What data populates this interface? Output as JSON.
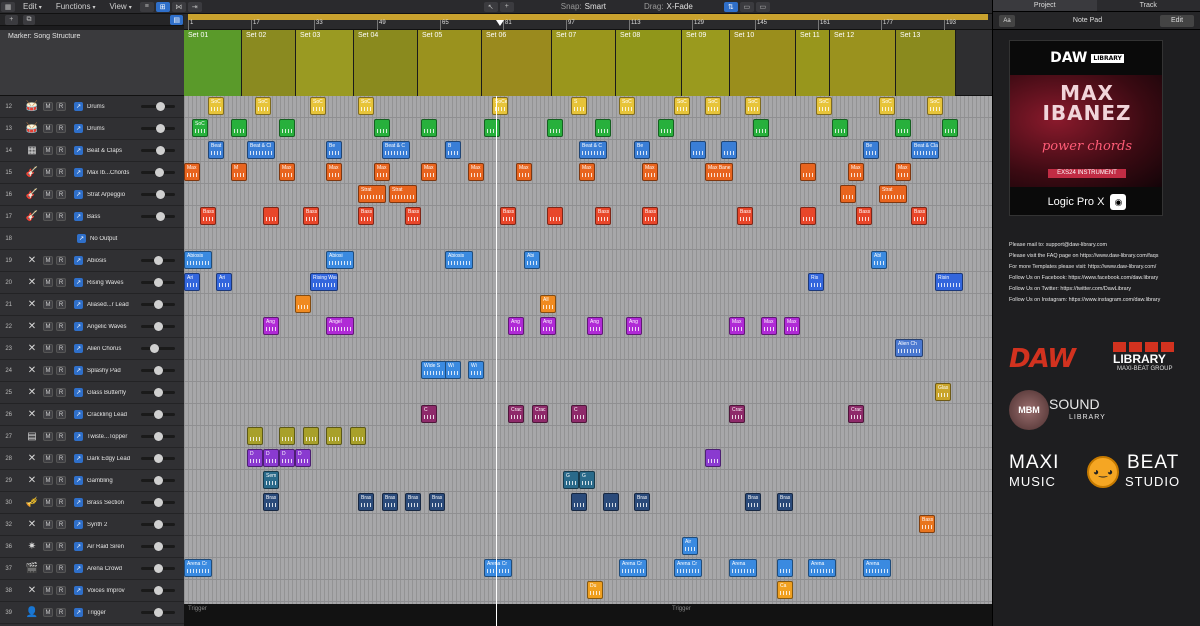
{
  "menubar": {
    "items": [
      {
        "label": "Edit"
      },
      {
        "label": "Functions"
      },
      {
        "label": "View"
      }
    ],
    "snap_label": "Snap:",
    "snap_value": "Smart",
    "drag_label": "Drag:",
    "drag_value": "X-Fade"
  },
  "ruler": {
    "ticks": [
      "1",
      "17",
      "33",
      "49",
      "65",
      "81",
      "97",
      "113",
      "129",
      "145",
      "161",
      "177",
      "193"
    ]
  },
  "marker_track": {
    "label": "Marker: Song Structure",
    "sets": [
      "Set 01",
      "Set 02",
      "Set 03",
      "Set 04",
      "Set 05",
      "Set 06",
      "Set 07",
      "Set 08",
      "Set 09",
      "Set 10",
      "Set 11",
      "Set 12",
      "Set 13"
    ]
  },
  "tracks": [
    {
      "num": "12",
      "name": "Drums",
      "icon": "drum-kit-icon",
      "color": "#e7c43a"
    },
    {
      "num": "13",
      "name": "Drums",
      "icon": "drum-kit-icon",
      "color": "#27b03c"
    },
    {
      "num": "14",
      "name": "Beat & Claps",
      "icon": "drum-machine-icon",
      "color": "#3a7ed6"
    },
    {
      "num": "15",
      "name": "Max Ib...Chords",
      "icon": "guitar-icon",
      "color": "#e8641e"
    },
    {
      "num": "16",
      "name": "Strat Arpeggio",
      "icon": "guitar-icon",
      "color": "#e8641e"
    },
    {
      "num": "17",
      "name": "Bass",
      "icon": "bass-guitar-icon",
      "color": "#e8462a"
    },
    {
      "num": "18",
      "name": "No Output",
      "icon": "none",
      "color": "#a7a7a9"
    },
    {
      "num": "19",
      "name": "Abiosis",
      "icon": "synth-icon",
      "color": "#3a8ae0"
    },
    {
      "num": "20",
      "name": "Rising Waves",
      "icon": "synth-icon",
      "color": "#3366dd"
    },
    {
      "num": "21",
      "name": "Aliased...r Lead",
      "icon": "synth-icon",
      "color": "#f08a20"
    },
    {
      "num": "22",
      "name": "Angelic Waves",
      "icon": "synth-icon",
      "color": "#b02ad6"
    },
    {
      "num": "23",
      "name": "Alien Chorus",
      "icon": "synth-icon",
      "color": "#4a78d0"
    },
    {
      "num": "24",
      "name": "Splashy Pad",
      "icon": "synth-icon",
      "color": "#3a8ae0"
    },
    {
      "num": "25",
      "name": "Glass Butterfly",
      "icon": "synth-icon",
      "color": "#c9a42a"
    },
    {
      "num": "26",
      "name": "Crackling Lead",
      "icon": "synth-icon",
      "color": "#8e2a6a"
    },
    {
      "num": "27",
      "name": "Twiste...Topper",
      "icon": "keyboard-icon",
      "color": "#a8a02a"
    },
    {
      "num": "28",
      "name": "Dark Edgy Lead",
      "icon": "synth-icon",
      "color": "#8a3ad0"
    },
    {
      "num": "29",
      "name": "Gambling",
      "icon": "synth-icon",
      "color": "#2a6a8a"
    },
    {
      "num": "30",
      "name": "Brass Section",
      "icon": "brass-icon",
      "color": "#2a4a7a"
    },
    {
      "num": "32",
      "name": "Synth 2",
      "icon": "synth-icon",
      "color": "#e8741e"
    },
    {
      "num": "36",
      "name": "Air Raid Siren",
      "icon": "siren-icon",
      "color": "#3a8ae0"
    },
    {
      "num": "37",
      "name": "Arena Crowd",
      "icon": "clapper-icon",
      "color": "#3a8ae0"
    },
    {
      "num": "38",
      "name": "Voices Improv",
      "icon": "synth-icon",
      "color": "#f0a020"
    },
    {
      "num": "39",
      "name": "Trigger",
      "icon": "drummer-icon",
      "color": "#222222"
    }
  ],
  "regions": [
    [
      [
        "SoC",
        0.03
      ],
      [
        "SoC",
        0.09
      ],
      [
        "SoC",
        0.16
      ],
      [
        "SoC",
        0.22
      ],
      [
        "SoCe",
        0.39
      ],
      [
        "S",
        0.49
      ],
      [
        "SoC",
        0.55
      ],
      [
        "SoC",
        0.62
      ],
      [
        "SoC",
        0.66
      ],
      [
        "SoC",
        0.71
      ],
      [
        "SoC",
        0.8
      ],
      [
        "SoC",
        0.88
      ],
      [
        "SoC",
        0.94
      ]
    ],
    [
      [
        "SoC",
        0.01
      ],
      [
        "",
        0.06
      ],
      [
        "",
        0.12
      ],
      [
        "",
        0.24
      ],
      [
        "",
        0.3
      ],
      [
        "",
        0.38
      ],
      [
        "",
        0.46
      ],
      [
        "",
        0.52
      ],
      [
        "",
        0.6
      ],
      [
        "",
        0.72
      ],
      [
        "",
        0.82
      ],
      [
        "",
        0.9
      ],
      [
        "",
        0.96
      ]
    ],
    [
      [
        "Beat",
        0.03
      ],
      [
        "Beat & Cl",
        0.08
      ],
      [
        "Be",
        0.18
      ],
      [
        "Beat & C",
        0.25
      ],
      [
        "B",
        0.33
      ],
      [
        "Beat & C",
        0.5
      ],
      [
        "Be",
        0.57
      ],
      [
        "",
        0.64
      ],
      [
        "",
        0.68
      ],
      [
        "Be",
        0.86
      ],
      [
        "Beat & Claps.7",
        0.92
      ]
    ],
    [
      [
        "Max",
        0.0
      ],
      [
        "M",
        0.06
      ],
      [
        "Max",
        0.12
      ],
      [
        "Max",
        0.18
      ],
      [
        "Max",
        0.24
      ],
      [
        "Max",
        0.3
      ],
      [
        "Max",
        0.36
      ],
      [
        "Max",
        0.42
      ],
      [
        "Max",
        0.5
      ],
      [
        "Max",
        0.58
      ],
      [
        "Max Bane",
        0.66
      ],
      [
        "",
        0.78
      ],
      [
        "Max",
        0.84
      ],
      [
        "Max",
        0.9
      ]
    ],
    [
      [
        "Strat",
        0.22
      ],
      [
        "Strat",
        0.26
      ],
      [
        "",
        0.83
      ],
      [
        "Strat",
        0.88
      ]
    ],
    [
      [
        "Bass",
        0.02
      ],
      [
        "",
        0.1
      ],
      [
        "Bass",
        0.15
      ],
      [
        "Bass",
        0.22
      ],
      [
        "Bass",
        0.28
      ],
      [
        "Bass",
        0.4
      ],
      [
        "",
        0.46
      ],
      [
        "Bass",
        0.52
      ],
      [
        "Bass",
        0.58
      ],
      [
        "Bass",
        0.7
      ],
      [
        "",
        0.78
      ],
      [
        "Bass",
        0.85
      ],
      [
        "Bass",
        0.92
      ]
    ],
    [],
    [
      [
        "Abiosis",
        0.0
      ],
      [
        "Abiosi",
        0.18
      ],
      [
        "Abiosis",
        0.33
      ],
      [
        "Abi",
        0.43
      ],
      [
        "Abl",
        0.87
      ]
    ],
    [
      [
        "Ari",
        0.0
      ],
      [
        "Ari",
        0.04
      ],
      [
        "Rising Wav",
        0.16
      ],
      [
        "Ris",
        0.79
      ],
      [
        "Risin",
        0.95
      ]
    ],
    [
      [
        "",
        0.14
      ],
      [
        "All",
        0.45
      ]
    ],
    [
      [
        "Ang",
        0.1
      ],
      [
        "Angel",
        0.18
      ],
      [
        "Ang",
        0.41
      ],
      [
        "Ang",
        0.45
      ],
      [
        "Ang",
        0.51
      ],
      [
        "Ang",
        0.56
      ],
      [
        "Max",
        0.69
      ],
      [
        "Max",
        0.73
      ],
      [
        "Max",
        0.76
      ]
    ],
    [
      [
        "Alien Ch",
        0.9
      ]
    ],
    [
      [
        "Wide S",
        0.3
      ],
      [
        "Wi",
        0.33
      ],
      [
        "Wi",
        0.36
      ]
    ],
    [
      [
        "Glas",
        0.95
      ]
    ],
    [
      [
        "C",
        0.3
      ],
      [
        "Crac",
        0.41
      ],
      [
        "Crac",
        0.44
      ],
      [
        "C",
        0.49
      ],
      [
        "Crac",
        0.69
      ],
      [
        "Crac",
        0.84
      ]
    ],
    [
      [
        "",
        0.08
      ],
      [
        "",
        0.12
      ],
      [
        "",
        0.15
      ],
      [
        "",
        0.18
      ],
      [
        "",
        0.21
      ]
    ],
    [
      [
        "D",
        0.08
      ],
      [
        "D",
        0.1
      ],
      [
        "D",
        0.12
      ],
      [
        "D",
        0.14
      ],
      [
        "",
        0.66
      ]
    ],
    [
      [
        "Sem",
        0.1
      ],
      [
        "G",
        0.48
      ],
      [
        "G",
        0.5
      ]
    ],
    [
      [
        "Bras",
        0.1
      ],
      [
        "Bras",
        0.22
      ],
      [
        "Bras",
        0.25
      ],
      [
        "Bras",
        0.28
      ],
      [
        "Bras",
        0.31
      ],
      [
        "",
        0.49
      ],
      [
        "",
        0.53
      ],
      [
        "Bras",
        0.57
      ],
      [
        "Bras",
        0.71
      ],
      [
        "Bras",
        0.75
      ]
    ],
    [
      [
        "Bass",
        0.93
      ]
    ],
    [
      [
        "Air",
        0.63
      ]
    ],
    [
      [
        "Arena Cr",
        0.0
      ],
      [
        "Arena Cr",
        0.38
      ],
      [
        "Arena Cr",
        0.55
      ],
      [
        "Arena Cr",
        0.62
      ],
      [
        "Arena",
        0.69
      ],
      [
        "",
        0.75
      ],
      [
        "Arena",
        0.79
      ],
      [
        "Arena",
        0.86
      ]
    ],
    [
      [
        "Du",
        0.51
      ],
      [
        "Ca",
        0.75
      ]
    ],
    []
  ],
  "arrange": {
    "trigger_label_1": "Trigger",
    "trigger_label_2": "Trigger"
  },
  "right_panel": {
    "tabs": [
      "Project",
      "Track"
    ],
    "aa_label": "Aa",
    "title": "Note Pad",
    "edit_label": "Edit",
    "promo": {
      "brand": "DAW",
      "brand_tag": "LIBRARY",
      "name_line1": "MAX",
      "name_line2": "IBANEZ",
      "subtitle": "power chords",
      "badge": "EXS24 INSTRUMENT",
      "footer": "Logic Pro X"
    },
    "notes": [
      "Please mail to: support@daw-library.com",
      "Please visit the FAQ page on https://www.daw-library.com/faqs",
      "For more Templates please visit: https://www.daw-library.com/",
      "Follow Us on Facebook: https://www.facebook.com/daw.library",
      "Follow Us on Twitter: https://twitter.com/DawLibrary",
      "Follow Us on Instagram: https://www.instagram.com/daw.library"
    ],
    "logo_daw": {
      "main": "DAW",
      "library": "LIBRARY",
      "group": "MAXI-BEAT GROUP"
    },
    "logo_mbm": {
      "circle": "MBM",
      "sound": "SOUND",
      "library": "LIBRARY"
    },
    "logo_maxi": {
      "left1": "MAXI",
      "left2": "MUSIC",
      "right1": "BEAT",
      "right2": "STUDIO"
    }
  }
}
